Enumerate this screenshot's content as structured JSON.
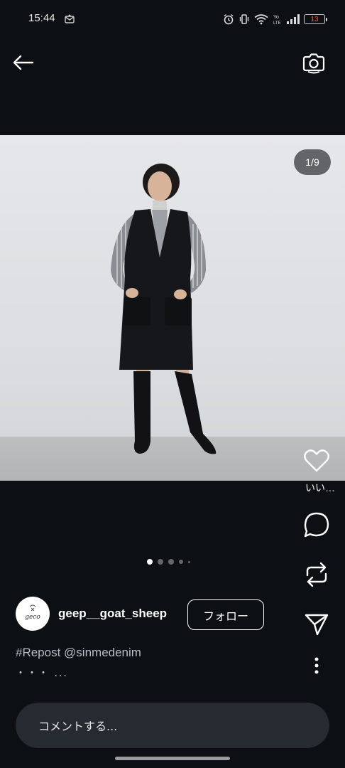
{
  "status_bar": {
    "time": "15:44",
    "icons": [
      "mail-notification-icon",
      "alarm-icon",
      "vibrate-icon",
      "wifi-icon",
      "volte-icon",
      "signal-icon",
      "battery-icon"
    ],
    "volte_label": "Yo LTE",
    "battery_level": "13"
  },
  "top_bar": {
    "back_icon": "arrow-left-icon",
    "camera_icon": "camera-rotate-icon"
  },
  "photo": {
    "counter": "1/9",
    "current_index": 1,
    "total": 9
  },
  "actions": {
    "like_label": "いい…",
    "icons": [
      "heart-icon",
      "comment-icon",
      "repost-icon",
      "share-icon",
      "more-vertical-icon"
    ]
  },
  "carousel": {
    "active_dot": 1
  },
  "author": {
    "username": "geep__goat_sheep",
    "avatar_text": "geco"
  },
  "follow_button": "フォロー",
  "caption": {
    "text": "#Repost @sinmedenim",
    "more": "・・・ ..."
  },
  "comment_input": {
    "placeholder": "コメントする..."
  },
  "colors": {
    "background": "#0c0f14",
    "comment_box": "#262a31",
    "caption_text": "#b8bcc4",
    "battery_low": "#ff4d4d"
  }
}
